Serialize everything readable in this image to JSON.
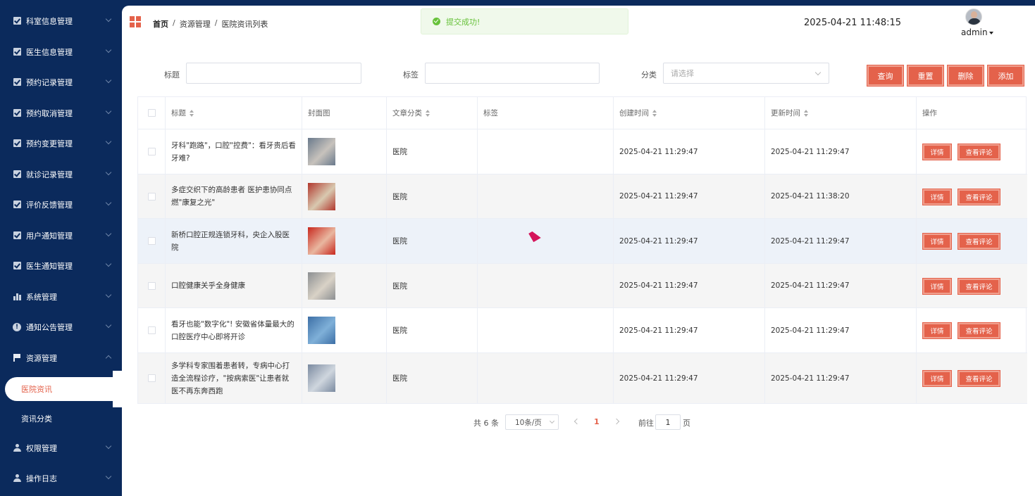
{
  "sidebar": {
    "items": [
      {
        "label": "科室信息管理",
        "icon": "check-square-icon"
      },
      {
        "label": "医生信息管理",
        "icon": "check-square-icon"
      },
      {
        "label": "预约记录管理",
        "icon": "check-square-icon"
      },
      {
        "label": "预约取消管理",
        "icon": "check-square-icon"
      },
      {
        "label": "预约变更管理",
        "icon": "check-square-icon"
      },
      {
        "label": "就诊记录管理",
        "icon": "check-square-icon"
      },
      {
        "label": "评价反馈管理",
        "icon": "check-square-icon"
      },
      {
        "label": "用户通知管理",
        "icon": "check-square-icon"
      },
      {
        "label": "医生通知管理",
        "icon": "check-square-icon"
      },
      {
        "label": "系统管理",
        "icon": "bar-chart-icon"
      },
      {
        "label": "通知公告管理",
        "icon": "info-icon"
      },
      {
        "label": "资源管理",
        "icon": "flag-icon"
      }
    ],
    "submenu": [
      {
        "label": "医院资讯",
        "active": true
      },
      {
        "label": "资讯分类",
        "active": false
      }
    ],
    "bottom_items": [
      {
        "label": "权限管理",
        "icon": "user-icon"
      },
      {
        "label": "操作日志",
        "icon": "user-icon"
      }
    ]
  },
  "header": {
    "breadcrumb": [
      "首页",
      "资源管理",
      "医院资讯列表"
    ],
    "datetime": "2025-04-21 11:48:15",
    "username": "admin"
  },
  "toast": {
    "message": "提交成功!"
  },
  "filters": {
    "title_label": "标题",
    "tag_label": "标签",
    "category_label": "分类",
    "category_placeholder": "请选择",
    "buttons": {
      "query": "查询",
      "reset": "重置",
      "delete": "删除",
      "add": "添加"
    }
  },
  "table": {
    "headers": {
      "title": "标题",
      "cover": "封面图",
      "category": "文章分类",
      "tag": "标签",
      "created": "创建时间",
      "updated": "更新时间",
      "actions": "操作"
    },
    "rows": [
      {
        "title": "牙科\"跑路\"，口腔\"控费\"：看牙贵后看牙难?",
        "category": "医院",
        "tag": "",
        "created": "2025-04-21 11:29:47",
        "updated": "2025-04-21 11:29:47"
      },
      {
        "title": "多症交织下的高龄患者 医护患协同点燃\"康复之光\"",
        "category": "医院",
        "tag": "",
        "created": "2025-04-21 11:29:47",
        "updated": "2025-04-21 11:38:20"
      },
      {
        "title": "新桥口腔正规连锁牙科，央企入股医院",
        "category": "医院",
        "tag": "",
        "created": "2025-04-21 11:29:47",
        "updated": "2025-04-21 11:29:47"
      },
      {
        "title": "口腔健康关乎全身健康",
        "category": "医院",
        "tag": "",
        "created": "2025-04-21 11:29:47",
        "updated": "2025-04-21 11:29:47"
      },
      {
        "title": "看牙也能\"数字化\"! 安徽省体量最大的口腔医疗中心即将开诊",
        "category": "医院",
        "tag": "",
        "created": "2025-04-21 11:29:47",
        "updated": "2025-04-21 11:29:47"
      },
      {
        "title": "多学科专家围着患者转，专病中心打造全流程诊疗，\"按病索医\"让患者就医不再东奔西跑",
        "category": "医院",
        "tag": "",
        "created": "2025-04-21 11:29:47",
        "updated": "2025-04-21 11:29:47"
      }
    ],
    "row_buttons": {
      "detail": "详情",
      "comments": "查看评论"
    }
  },
  "pagination": {
    "total": "共 6 条",
    "page_size": "10条/页",
    "current_page": "1",
    "goto_label": "前往",
    "goto_value": "1",
    "page_unit": "页"
  },
  "colors": {
    "sidebar_bg": "#0b2a5c",
    "accent": "#e4624b",
    "success": "#67c23a"
  }
}
